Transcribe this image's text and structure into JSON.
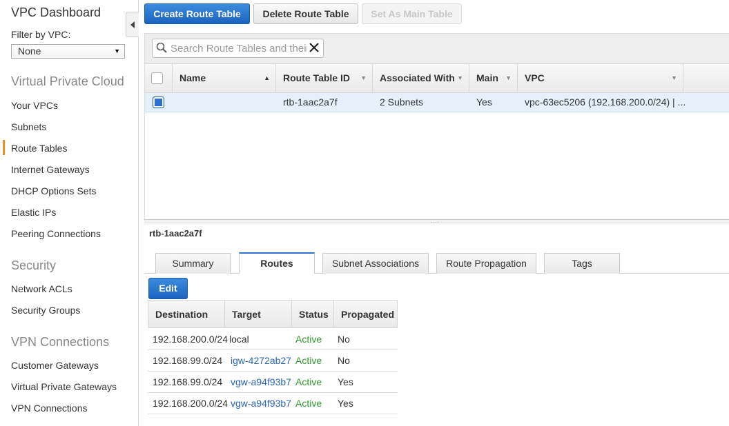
{
  "sidebar": {
    "title": "VPC Dashboard",
    "filter_label": "Filter by VPC:",
    "filter_value": "None",
    "sections": [
      {
        "label": "Virtual Private Cloud"
      },
      {
        "label": "Security"
      },
      {
        "label": "VPN Connections"
      }
    ],
    "items": [
      {
        "label": "Your VPCs"
      },
      {
        "label": "Subnets"
      },
      {
        "label": "Route Tables"
      },
      {
        "label": "Internet Gateways"
      },
      {
        "label": "DHCP Options Sets"
      },
      {
        "label": "Elastic IPs"
      },
      {
        "label": "Peering Connections"
      },
      {
        "label": "Network ACLs"
      },
      {
        "label": "Security Groups"
      },
      {
        "label": "Customer Gateways"
      },
      {
        "label": "Virtual Private Gateways"
      },
      {
        "label": "VPN Connections"
      }
    ]
  },
  "toolbar": {
    "create_label": "Create Route Table",
    "delete_label": "Delete Route Table",
    "set_main_label": "Set As Main Table"
  },
  "search": {
    "placeholder": "Search Route Tables and their"
  },
  "grid": {
    "columns": [
      "Name",
      "Route Table ID",
      "Associated With",
      "Main",
      "VPC"
    ],
    "rows": [
      {
        "name": "",
        "id": "rtb-1aac2a7f",
        "associated": "2 Subnets",
        "main": "Yes",
        "vpc": "vpc-63ec5206 (192.168.200.0/24) | ..."
      }
    ]
  },
  "details": {
    "title": "rtb-1aac2a7f",
    "tabs": [
      "Summary",
      "Routes",
      "Subnet Associations",
      "Route Propagation",
      "Tags"
    ],
    "active_tab": "Routes",
    "edit_label": "Edit",
    "routes_columns": [
      "Destination",
      "Target",
      "Status",
      "Propagated"
    ],
    "routes": [
      {
        "destination": "192.168.200.0/24",
        "target": "local",
        "status": "Active",
        "propagated": "No"
      },
      {
        "destination": "192.168.99.0/24",
        "target": "igw-4272ab27",
        "status": "Active",
        "propagated": "No"
      },
      {
        "destination": "192.168.99.0/24",
        "target": "vgw-a94f93b7",
        "status": "Active",
        "propagated": "Yes"
      },
      {
        "destination": "192.168.200.0/24",
        "target": "vgw-a94f93b7",
        "status": "Active",
        "propagated": "Yes"
      }
    ]
  },
  "colors": {
    "primary": "#1c63c0",
    "active_nav": "#e88f24",
    "status_active": "#2e9a2e",
    "link": "#2a64b5"
  }
}
